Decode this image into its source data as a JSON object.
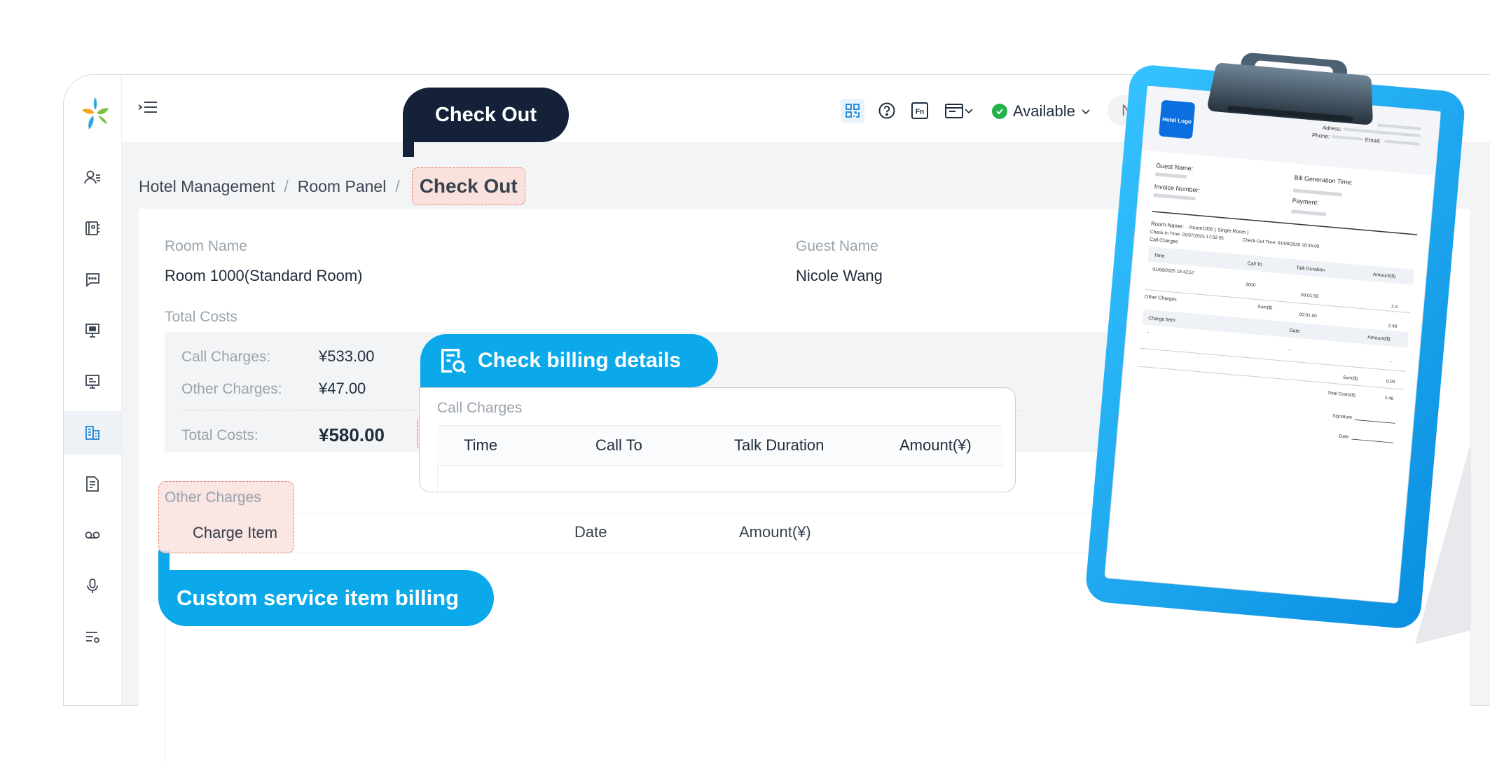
{
  "topbar": {
    "status_label": "Available",
    "search_placeholder": "Number"
  },
  "breadcrumb": {
    "items": [
      "Hotel Management",
      "Room Panel"
    ],
    "separator": "/",
    "current": "Check Out"
  },
  "room": {
    "room_name_label": "Room Name",
    "room_name_value": "Room 1000(Standard Room)",
    "guest_name_label": "Guest Name",
    "guest_name_value": "Nicole Wang"
  },
  "costs": {
    "section_label": "Total Costs",
    "call_charges_label": "Call Charges:",
    "call_charges_value": "¥533.00",
    "other_charges_label": "Other Charges:",
    "other_charges_value": "¥47.00",
    "total_label": "Total Costs:",
    "total_value": "¥580.00"
  },
  "other_charges_table": {
    "section_label": "Other Charges",
    "columns": [
      "Charge Item",
      "Date",
      "Amount(¥)"
    ]
  },
  "billing_popup": {
    "title": "Call Charges",
    "columns": [
      "Time",
      "Call To",
      "Talk Duration",
      "Amount(¥)"
    ]
  },
  "callouts": {
    "check_out": "Check Out",
    "billing": "Check billing details",
    "custom": "Custom service item billing"
  },
  "invoice": {
    "logo_text": "Hotel Logo",
    "address_label": "Adress:",
    "phone_label": "Phone:",
    "email_label": "Email:",
    "guest_name_label": "Guest Name:",
    "bill_time_label": "Bill Generation Time:",
    "invoice_number_label": "Invoice Number:",
    "payment_label": "Payment:",
    "room_name_label": "Room Name:",
    "room_name_value": "Room1000 ( Single Room )",
    "check_in": "Check-In Time: 01/07/2025 17:02:55",
    "check_out": "Check-Out Time: 01/08/2025 18:45:00",
    "call_charges_label": "Call Charges",
    "call_cols": [
      "Time",
      "Call To",
      "Talk Duration",
      "Amount($)"
    ],
    "call_row": [
      "01/08/2025 18:42:57",
      "3000",
      "00:01:50",
      "2.4"
    ],
    "other_charges_label": "Other Charges",
    "sum_label": "Sum($)",
    "sum_duration": "00:01:50",
    "sum_amount": "2.40",
    "charge_cols": [
      "Charge Item",
      "Date",
      "Amount($)"
    ],
    "charge_row": [
      "-",
      "-",
      "-"
    ],
    "sum2_label": "Sum($)",
    "sum2_value": "0.00",
    "total_label": "Total Costs($)",
    "total_value": "2.40",
    "signature_label": "Signature",
    "date_label": "Date"
  },
  "colors": {
    "accent_blue": "#0ba9ea",
    "dark_navy": "#142138",
    "highlight_fill": "#f9e2de",
    "highlight_border": "#e37f72",
    "status_green": "#21b24b"
  }
}
